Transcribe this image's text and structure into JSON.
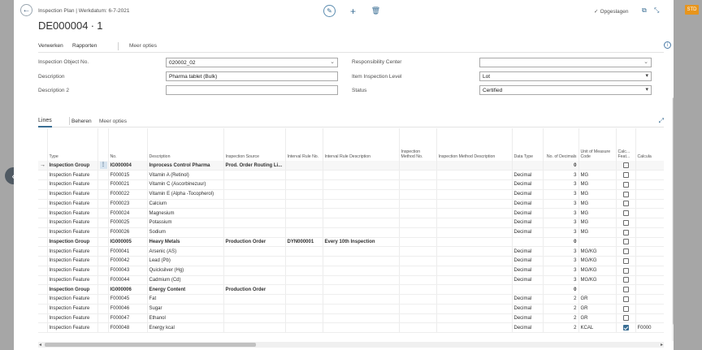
{
  "header": {
    "caption": "Inspection Plan | Werkdatum: 6-7-2021",
    "title": "DE000004 ∙ 1",
    "saved_label": "Opgeslagen",
    "badge": "STD"
  },
  "actions": {
    "process": "Verwerken",
    "reports": "Rapporten",
    "more": "Meer opties"
  },
  "fields": {
    "inspection_object_no": {
      "label": "Inspection Object No.",
      "value": "020002_02"
    },
    "description": {
      "label": "Description",
      "value": "Pharma tablet (Bulk)"
    },
    "description2": {
      "label": "Description 2",
      "value": ""
    },
    "responsibility_center": {
      "label": "Responsibility Center",
      "value": ""
    },
    "item_inspection_level": {
      "label": "Item Inspection Level",
      "value": "Lot"
    },
    "status": {
      "label": "Status",
      "value": "Certified"
    }
  },
  "lines": {
    "title": "Lines",
    "manage": "Beheren",
    "more": "Meer opties",
    "columns": {
      "type": "Type",
      "no": "No.",
      "description": "Description",
      "inspection_source": "Inspection Source",
      "interval_rule_no": "Interval Rule No.",
      "interval_rule_description": "Interval Rule Description",
      "inspection_method_no": "Inspection Method No.",
      "inspection_method_description": "Inspection Method Description",
      "data_type": "Data Type",
      "no_of_decimals": "No. of Decimals",
      "unit_of_measure_code": "Unit of Measure Code",
      "calc_feat": "Calc... Feat...",
      "calc": "Calcula"
    },
    "rows": [
      {
        "type": "Inspection Group",
        "no": "IG000004",
        "description": "Inprocess Control Pharma",
        "inspection_source": "Prod. Order Routing Li...",
        "interval_rule_no": "",
        "interval_rule_description": "",
        "data_type": "",
        "decimals": "0",
        "uom": "",
        "calc": false,
        "calc_text": "",
        "group": true,
        "selected": true
      },
      {
        "type": "Inspection Feature",
        "no": "F000015",
        "description": "Vitamin A (Retinol)",
        "inspection_source": "",
        "interval_rule_no": "",
        "interval_rule_description": "",
        "data_type": "Decimal",
        "decimals": "3",
        "uom": "MG",
        "calc": false,
        "calc_text": "",
        "group": false
      },
      {
        "type": "Inspection Feature",
        "no": "F000021",
        "description": "Vitamin C (Ascorbinezuur)",
        "inspection_source": "",
        "interval_rule_no": "",
        "interval_rule_description": "",
        "data_type": "Decimal",
        "decimals": "3",
        "uom": "MG",
        "calc": false,
        "calc_text": "",
        "group": false
      },
      {
        "type": "Inspection Feature",
        "no": "F000022",
        "description": "Vitamin E (Alpha -Tocopherol)",
        "inspection_source": "",
        "interval_rule_no": "",
        "interval_rule_description": "",
        "data_type": "Decimal",
        "decimals": "3",
        "uom": "MG",
        "calc": false,
        "calc_text": "",
        "group": false
      },
      {
        "type": "Inspection Feature",
        "no": "F000023",
        "description": "Calcium",
        "inspection_source": "",
        "interval_rule_no": "",
        "interval_rule_description": "",
        "data_type": "Decimal",
        "decimals": "3",
        "uom": "MG",
        "calc": false,
        "calc_text": "",
        "group": false
      },
      {
        "type": "Inspection Feature",
        "no": "F000024",
        "description": "Magnesium",
        "inspection_source": "",
        "interval_rule_no": "",
        "interval_rule_description": "",
        "data_type": "Decimal",
        "decimals": "3",
        "uom": "MG",
        "calc": false,
        "calc_text": "",
        "group": false
      },
      {
        "type": "Inspection Feature",
        "no": "F000025",
        "description": "Potassium",
        "inspection_source": "",
        "interval_rule_no": "",
        "interval_rule_description": "",
        "data_type": "Decimal",
        "decimals": "3",
        "uom": "MG",
        "calc": false,
        "calc_text": "",
        "group": false
      },
      {
        "type": "Inspection Feature",
        "no": "F000026",
        "description": "Sodium",
        "inspection_source": "",
        "interval_rule_no": "",
        "interval_rule_description": "",
        "data_type": "Decimal",
        "decimals": "3",
        "uom": "MG",
        "calc": false,
        "calc_text": "",
        "group": false
      },
      {
        "type": "Inspection Group",
        "no": "IG000005",
        "description": "Heavy Metals",
        "inspection_source": "Production Order",
        "interval_rule_no": "DYN000001",
        "interval_rule_description": "Every 10th Inspection",
        "data_type": "",
        "decimals": "0",
        "uom": "",
        "calc": false,
        "calc_text": "",
        "group": true
      },
      {
        "type": "Inspection Feature",
        "no": "F000041",
        "description": "Arsenic (AS)",
        "inspection_source": "",
        "interval_rule_no": "",
        "interval_rule_description": "",
        "data_type": "Decimal",
        "decimals": "3",
        "uom": "MG/KG",
        "calc": false,
        "calc_text": "",
        "group": false
      },
      {
        "type": "Inspection Feature",
        "no": "F000042",
        "description": "Lead (Pb)",
        "inspection_source": "",
        "interval_rule_no": "",
        "interval_rule_description": "",
        "data_type": "Decimal",
        "decimals": "3",
        "uom": "MG/KG",
        "calc": false,
        "calc_text": "",
        "group": false
      },
      {
        "type": "Inspection Feature",
        "no": "F000043",
        "description": "Quicksilver (Hg)",
        "inspection_source": "",
        "interval_rule_no": "",
        "interval_rule_description": "",
        "data_type": "Decimal",
        "decimals": "3",
        "uom": "MG/KG",
        "calc": false,
        "calc_text": "",
        "group": false
      },
      {
        "type": "Inspection Feature",
        "no": "F000044",
        "description": "Cadmium (Cd)",
        "inspection_source": "",
        "interval_rule_no": "",
        "interval_rule_description": "",
        "data_type": "Decimal",
        "decimals": "3",
        "uom": "MG/KG",
        "calc": false,
        "calc_text": "",
        "group": false
      },
      {
        "type": "Inspection Group",
        "no": "IG000006",
        "description": "Energy Content",
        "inspection_source": "Production Order",
        "interval_rule_no": "",
        "interval_rule_description": "",
        "data_type": "",
        "decimals": "0",
        "uom": "",
        "calc": false,
        "calc_text": "",
        "group": true
      },
      {
        "type": "Inspection Feature",
        "no": "F000045",
        "description": "Fat",
        "inspection_source": "",
        "interval_rule_no": "",
        "interval_rule_description": "",
        "data_type": "Decimal",
        "decimals": "2",
        "uom": "GR",
        "calc": false,
        "calc_text": "",
        "group": false
      },
      {
        "type": "Inspection Feature",
        "no": "F000046",
        "description": "Sugar",
        "inspection_source": "",
        "interval_rule_no": "",
        "interval_rule_description": "",
        "data_type": "Decimal",
        "decimals": "2",
        "uom": "GR",
        "calc": false,
        "calc_text": "",
        "group": false
      },
      {
        "type": "Inspection Feature",
        "no": "F000047",
        "description": "Ethanol",
        "inspection_source": "",
        "interval_rule_no": "",
        "interval_rule_description": "",
        "data_type": "Decimal",
        "decimals": "2",
        "uom": "GR",
        "calc": false,
        "calc_text": "",
        "group": false
      },
      {
        "type": "Inspection Feature",
        "no": "F000048",
        "description": "Energy kcal",
        "inspection_source": "",
        "interval_rule_no": "",
        "interval_rule_description": "",
        "data_type": "Decimal",
        "decimals": "2",
        "uom": "KCAL",
        "calc": true,
        "calc_text": "F0000",
        "group": false
      }
    ]
  },
  "icons": {
    "back": "arrow-left-icon",
    "edit": "pencil-icon",
    "add": "plus-icon",
    "delete": "trash-icon",
    "saved": "check-icon",
    "popout": "popout-icon",
    "collapse": "collapse-icon",
    "info": "info-icon",
    "expand": "expand-icon",
    "side": "chevron-left-icon"
  },
  "colors": {
    "accent": "#3a6e94",
    "badge": "#e8951c",
    "backdrop": "#a6a6a6"
  }
}
